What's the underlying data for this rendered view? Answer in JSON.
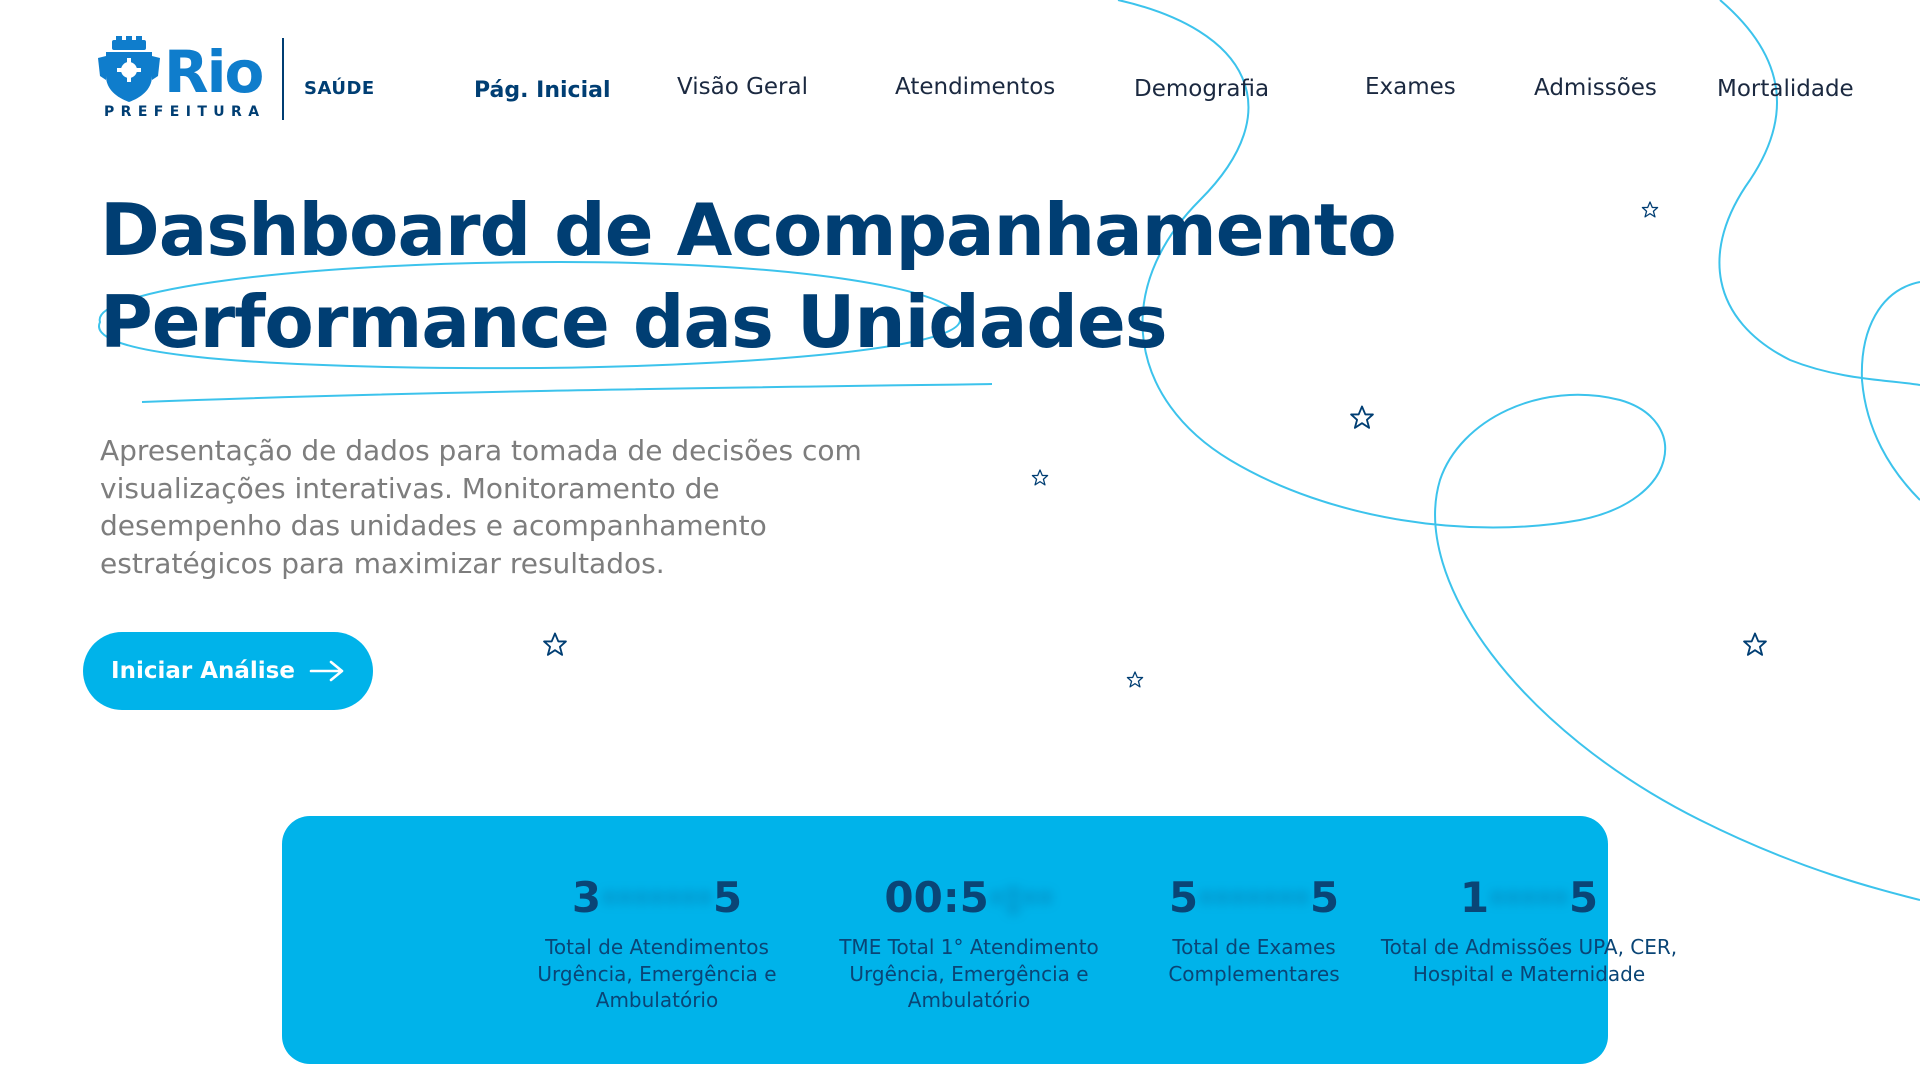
{
  "header": {
    "logo": {
      "brand": "Rio",
      "sub": "PREFEITURA",
      "section": "SAÚDE"
    },
    "nav": [
      {
        "label": "Pág. Inicial",
        "active": true
      },
      {
        "label": "Visão Geral",
        "active": false
      },
      {
        "label": "Atendimentos",
        "active": false
      },
      {
        "label": "Demografia",
        "active": false
      },
      {
        "label": "Exames",
        "active": false
      },
      {
        "label": "Admissões",
        "active": false
      },
      {
        "label": "Mortalidade",
        "active": false
      }
    ]
  },
  "hero": {
    "title_line1": "Dashboard de Acompanhamento",
    "title_line2": "Performance das Unidades",
    "description": "Apresentação de dados para tomada de decisões com visualizações interativas. Monitoramento de desempenho das unidades e acompanhamento estratégicos para maximizar resultados.",
    "cta_label": "Iniciar Análise",
    "cta_icon": "arrow-right-icon"
  },
  "stats": [
    {
      "value_start": "3",
      "value_blur": "·······",
      "value_end": "5",
      "label": "Total de Atendimentos Urgência, Emergência e Ambulatório"
    },
    {
      "value_start": "00:5",
      "value_blur": "·:··",
      "value_end": "",
      "label": "TME Total 1° Atendimento Urgência, Emergência e Ambulatório"
    },
    {
      "value_start": "5",
      "value_blur": "·······",
      "value_end": "5",
      "label": "Total de Exames Complementares"
    },
    {
      "value_start": "1",
      "value_blur": "·····",
      "value_end": "5",
      "label": "Total de Admissões UPA, CER, Hospital e Maternidade"
    }
  ],
  "colors": {
    "primary_dark": "#003e73",
    "accent": "#00b3ea",
    "brand_blue": "#0f7dcc",
    "text_muted": "#7d7d7d",
    "decor_line": "#3cc3ec"
  }
}
